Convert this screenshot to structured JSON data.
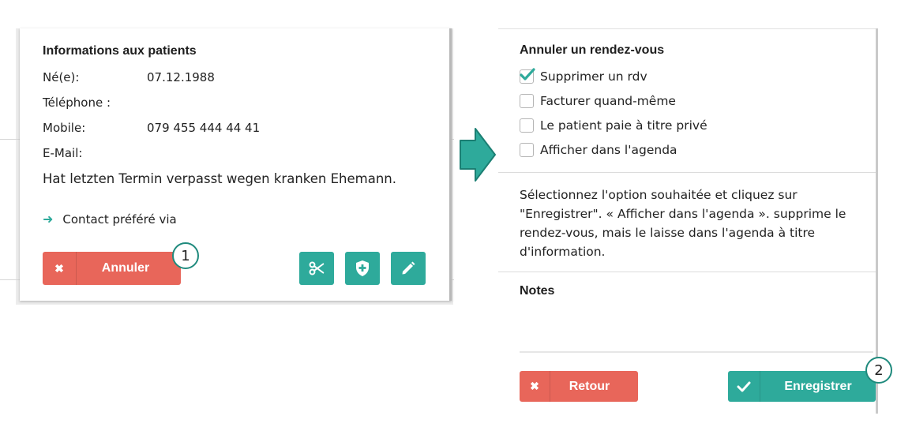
{
  "patient_info": {
    "title": "Informations aux patients",
    "fields": [
      {
        "label": "Né(e):",
        "value": "07.12.1988"
      },
      {
        "label": "Téléphone :",
        "value": ""
      },
      {
        "label": "Mobile:",
        "value": "079 455 444 44 41"
      },
      {
        "label": "E-Mail:",
        "value": ""
      }
    ],
    "note": "Hat letzten Termin verpasst wegen kranken Ehemann.",
    "contact_label": "Contact préféré via",
    "cancel_button": "Annuler",
    "action_icons": [
      "scissors-icon",
      "shield-plus-icon",
      "pencil-icon"
    ]
  },
  "badges": {
    "step1": "1",
    "step2": "2"
  },
  "cancel_dialog": {
    "title": "Annuler un rendez-vous",
    "options": [
      {
        "label": "Supprimer un rdv",
        "checked": true
      },
      {
        "label": "Facturer quand-même",
        "checked": false
      },
      {
        "label": "Le patient paie à titre privé",
        "checked": false
      },
      {
        "label": "Afficher dans l'agenda",
        "checked": false
      }
    ],
    "info_text": "Sélectionnez l'option souhaitée et cliquez sur \"Enregistrer\". « Afficher dans l'agenda ».  supprime le rendez-vous, mais le laisse dans l'agenda à titre d'information.",
    "notes_label": "Notes",
    "back_button": "Retour",
    "save_button": "Enregistrer"
  },
  "colors": {
    "teal": "#2eaa9b",
    "red": "#e8665a",
    "arrow": "#1f8a7d"
  }
}
